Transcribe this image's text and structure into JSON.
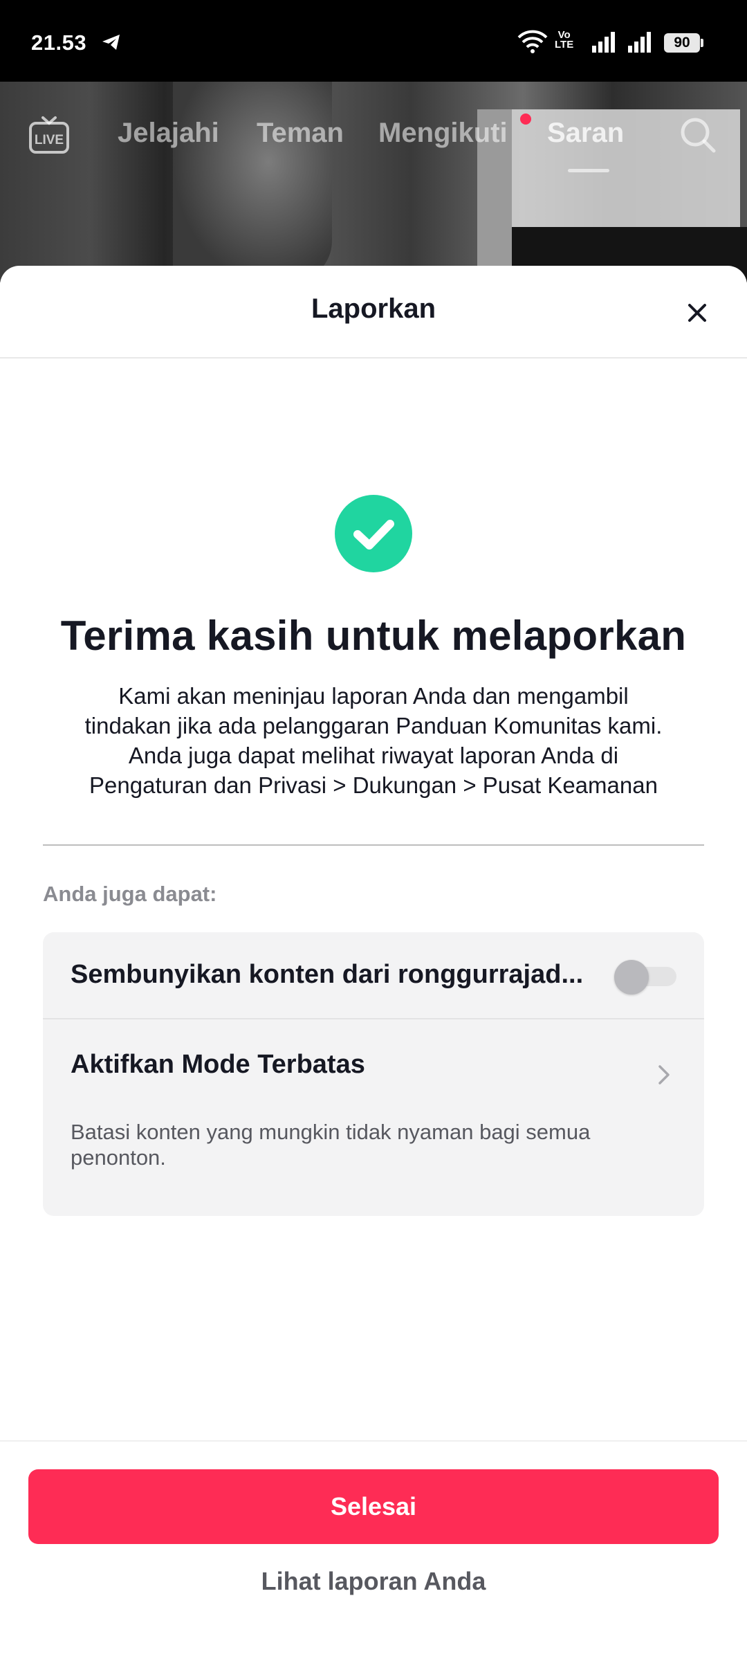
{
  "status_bar": {
    "time": "21.53",
    "network_label_top": "Vo",
    "network_label_bottom": "LTE",
    "battery": "90"
  },
  "top_nav": {
    "live_icon": "live-tv-icon",
    "tabs": [
      {
        "label": "Jelajahi"
      },
      {
        "label": "Teman"
      },
      {
        "label": "Mengikuti"
      },
      {
        "label": "Saran"
      }
    ],
    "active_tab": "Saran",
    "search_icon": "search-icon"
  },
  "sheet": {
    "title": "Laporkan",
    "close_icon": "close-icon"
  },
  "confirmation": {
    "icon": "check-circle-icon",
    "title": "Terima kasih untuk melaporkan",
    "body_lines": [
      "Kami akan meninjau laporan Anda dan mengambil",
      "tindakan jika ada pelanggaran Panduan Komunitas kami.",
      "Anda juga dapat melihat riwayat laporan Anda di",
      "Pengaturan dan Privasi > Dukungan > Pusat Keamanan"
    ]
  },
  "options": {
    "section_label": "Anda juga dapat:",
    "hide_content": {
      "label": "Sembunyikan konten dari ronggurrajad...",
      "toggle_on": false
    },
    "restricted_mode": {
      "label": "Aktifkan Mode Terbatas",
      "description": "Batasi konten yang mungkin tidak nyaman bagi semua penonton."
    }
  },
  "footer": {
    "done_label": "Selesai",
    "view_reports_label": "Lihat laporan Anda"
  },
  "colors": {
    "accent": "#fe2c55",
    "success": "#20d5a0",
    "text_primary": "#161823",
    "text_secondary": "#57585f"
  }
}
